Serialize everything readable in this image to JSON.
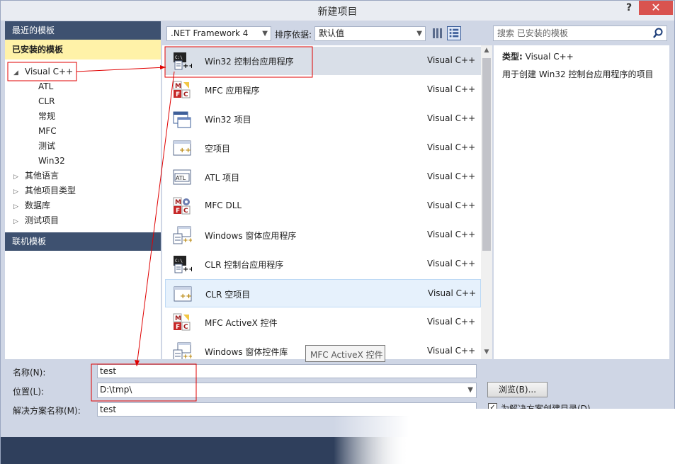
{
  "window": {
    "title": "新建项目",
    "help": "?",
    "close": "✕"
  },
  "left": {
    "recent": "最近的模板",
    "installed": "已安装的模板",
    "tree": [
      {
        "label": "Visual C++",
        "expanded": true,
        "indent": 0
      },
      {
        "label": "ATL",
        "indent": 1
      },
      {
        "label": "CLR",
        "indent": 1
      },
      {
        "label": "常规",
        "indent": 1
      },
      {
        "label": "MFC",
        "indent": 1
      },
      {
        "label": "测试",
        "indent": 1
      },
      {
        "label": "Win32",
        "indent": 1
      },
      {
        "label": "其他语言",
        "expanded": false,
        "indent": 0
      },
      {
        "label": "其他项目类型",
        "expanded": false,
        "indent": 0
      },
      {
        "label": "数据库",
        "expanded": false,
        "indent": 0
      },
      {
        "label": "测试项目",
        "expanded": false,
        "indent": 0
      }
    ],
    "online": "联机模板"
  },
  "toolbar": {
    "framework": ".NET Framework 4",
    "sort_label": "排序依据:",
    "sort_value": "默认值",
    "search_placeholder": "搜索 已安装的模板"
  },
  "templates": [
    {
      "name": "Win32 控制台应用程序",
      "lang": "Visual C++",
      "icon": "console-app-icon",
      "state": "selected"
    },
    {
      "name": "MFC 应用程序",
      "lang": "Visual C++",
      "icon": "mfc-icon"
    },
    {
      "name": "Win32 项目",
      "lang": "Visual C++",
      "icon": "window-icon"
    },
    {
      "name": "空项目",
      "lang": "Visual C++",
      "icon": "empty-project-icon"
    },
    {
      "name": "ATL 项目",
      "lang": "Visual C++",
      "icon": "atl-icon"
    },
    {
      "name": "MFC DLL",
      "lang": "Visual C++",
      "icon": "mfc-dll-icon"
    },
    {
      "name": "Windows 窗体应用程序",
      "lang": "Visual C++",
      "icon": "forms-app-icon"
    },
    {
      "name": "CLR 控制台应用程序",
      "lang": "Visual C++",
      "icon": "console-app-icon"
    },
    {
      "name": "CLR 空项目",
      "lang": "Visual C++",
      "icon": "empty-project-icon",
      "state": "hover"
    },
    {
      "name": "MFC ActiveX 控件",
      "lang": "Visual C++",
      "icon": "mfc-icon"
    },
    {
      "name": "Windows 窗体控件库",
      "lang": "Visual C++",
      "icon": "forms-app-icon"
    }
  ],
  "description": {
    "type_label": "类型:",
    "type_value": "Visual C++",
    "text": "用于创建 Win32 控制台应用程序的项目"
  },
  "bottom": {
    "name_label": "名称(N):",
    "name_value": "test",
    "location_label": "位置(L):",
    "location_value": "D:\\tmp\\",
    "solution_label": "解决方案名称(M):",
    "solution_value": "test",
    "browse": "浏览(B)...",
    "checkbox_label": "为解决方案创建目录(D)"
  },
  "tooltip": "MFC ActiveX 控件",
  "colors": {
    "header": "#3e5170",
    "installed_bg": "#fff2a8",
    "annotation": "#e00000"
  }
}
